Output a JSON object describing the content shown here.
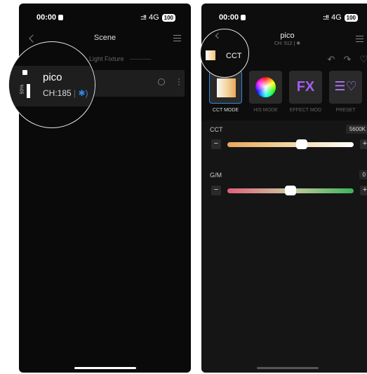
{
  "status": {
    "time": "00:00",
    "signal": "::!!",
    "network": "4G",
    "battery": "100"
  },
  "left": {
    "nav_title": "Scene",
    "section_label": "Light Fixture",
    "fixture": {
      "name": "pico",
      "brightness": "50%",
      "channel": "CH:185",
      "separator": "|",
      "bluetooth_glyph": "✱)"
    }
  },
  "right": {
    "device_name": "pico",
    "device_sub": "CH: 512 | ✱",
    "current_mode_label": "CCT",
    "toolbar_icons": [
      "undo-icon",
      "redo-icon",
      "favorite-add-icon"
    ],
    "modes": [
      {
        "label": "CCT MODE",
        "active": true,
        "icon": "cct-swatch-icon"
      },
      {
        "label": "HIS MODE",
        "active": false,
        "icon": "color-wheel-icon"
      },
      {
        "label": "EFFECT MOD",
        "active": false,
        "icon": "fx-icon",
        "glyph": "FX"
      },
      {
        "label": "PRESET",
        "active": false,
        "icon": "preset-icon",
        "glyph": "☰♡"
      }
    ],
    "sliders": [
      {
        "label": "CCT",
        "value": "5600K",
        "position": 0.59,
        "gradient": [
          "#e9a85b",
          "#f3d7a4",
          "#ffffff"
        ]
      },
      {
        "label": "G/M",
        "value": "0",
        "position": 0.5,
        "gradient": [
          "#e0607a",
          "#c9c9a0",
          "#3cb35b"
        ]
      }
    ],
    "minus": "−",
    "plus": "+"
  },
  "colors": {
    "accent": "#2e8ae6",
    "background": "#0a0a0a",
    "card": "#1e1e1e"
  }
}
